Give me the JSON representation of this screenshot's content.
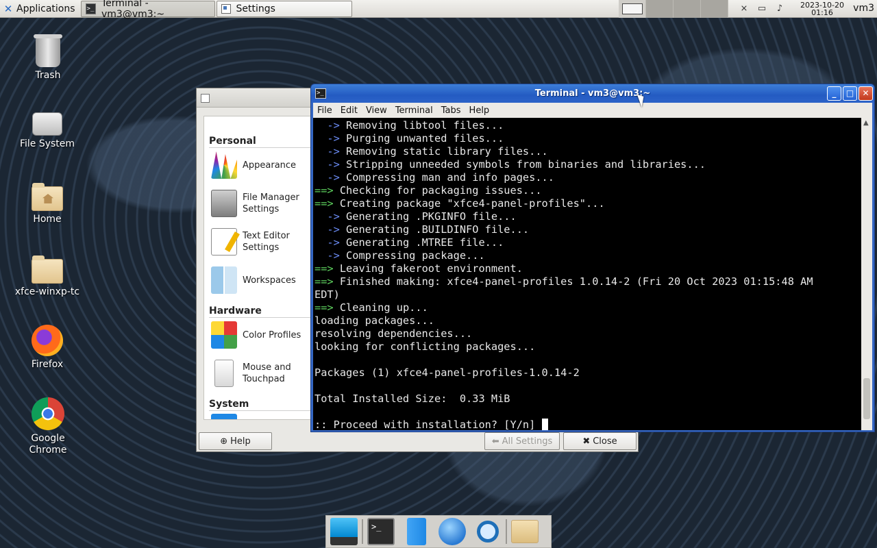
{
  "top_panel": {
    "applications_label": "Applications",
    "tasks": [
      {
        "label": "Terminal - vm3@vm3:~",
        "active": true
      },
      {
        "label": "Settings",
        "active": false
      }
    ],
    "workspace_count": 4,
    "current_workspace": 1,
    "tray_icons": [
      "network-disabled-icon",
      "battery-icon",
      "notification-icon"
    ],
    "clock_date": "2023-10-20",
    "clock_time": "01:16",
    "user": "vm3"
  },
  "desktop_icons": [
    {
      "label": "Trash",
      "icon": "trash-icon"
    },
    {
      "label": "File System",
      "icon": "drive-icon"
    },
    {
      "label": "Home",
      "icon": "home-folder-icon"
    },
    {
      "label": "xfce-winxp-tc",
      "icon": "folder-icon"
    },
    {
      "label": "Firefox",
      "icon": "firefox-icon"
    },
    {
      "label": "Google Chrome",
      "icon": "chrome-icon"
    }
  ],
  "settings_window": {
    "sections": {
      "personal": "Personal",
      "hardware": "Hardware",
      "system": "System"
    },
    "items": [
      {
        "label": "Appearance",
        "icon": "appearance-icon"
      },
      {
        "label": "File Manager Settings",
        "icon": "file-manager-icon"
      },
      {
        "label": "Text Editor Settings",
        "icon": "text-editor-icon"
      },
      {
        "label": "Workspaces",
        "icon": "workspaces-icon"
      },
      {
        "label": "Color Profiles",
        "icon": "color-profiles-icon"
      },
      {
        "label": "Mouse and Touchpad",
        "icon": "mouse-icon"
      }
    ],
    "help_label": "Help",
    "all_settings_label": "All Settings",
    "close_label": "Close"
  },
  "terminal": {
    "title": "Terminal - vm3@vm3:~",
    "menu": [
      "File",
      "Edit",
      "View",
      "Terminal",
      "Tabs",
      "Help"
    ],
    "lines": [
      {
        "prefix": "  ->",
        "kind": "sub",
        "text": " Removing libtool files..."
      },
      {
        "prefix": "  ->",
        "kind": "sub",
        "text": " Purging unwanted files..."
      },
      {
        "prefix": "  ->",
        "kind": "sub",
        "text": " Removing static library files..."
      },
      {
        "prefix": "  ->",
        "kind": "sub",
        "text": " Stripping unneeded symbols from binaries and libraries..."
      },
      {
        "prefix": "  ->",
        "kind": "sub",
        "text": " Compressing man and info pages..."
      },
      {
        "prefix": "==>",
        "kind": "main",
        "text": " Checking for packaging issues..."
      },
      {
        "prefix": "==>",
        "kind": "main",
        "text": " Creating package \"xfce4-panel-profiles\"..."
      },
      {
        "prefix": "  ->",
        "kind": "sub",
        "text": " Generating .PKGINFO file..."
      },
      {
        "prefix": "  ->",
        "kind": "sub",
        "text": " Generating .BUILDINFO file..."
      },
      {
        "prefix": "  ->",
        "kind": "sub",
        "text": " Generating .MTREE file..."
      },
      {
        "prefix": "  ->",
        "kind": "sub",
        "text": " Compressing package..."
      },
      {
        "prefix": "==>",
        "kind": "main",
        "text": " Leaving fakeroot environment."
      },
      {
        "prefix": "==>",
        "kind": "main",
        "text": " Finished making: xfce4-panel-profiles 1.0.14-2 (Fri 20 Oct 2023 01:15:48 AM"
      },
      {
        "prefix": "",
        "kind": "plain",
        "text": "EDT)"
      },
      {
        "prefix": "==>",
        "kind": "main",
        "text": " Cleaning up..."
      },
      {
        "prefix": "",
        "kind": "plain",
        "text": "loading packages..."
      },
      {
        "prefix": "",
        "kind": "plain",
        "text": "resolving dependencies..."
      },
      {
        "prefix": "",
        "kind": "plain",
        "text": "looking for conflicting packages..."
      },
      {
        "prefix": "",
        "kind": "plain",
        "text": ""
      },
      {
        "prefix": "",
        "kind": "plain",
        "text": "Packages (1) xfce4-panel-profiles-1.0.14-2"
      },
      {
        "prefix": "",
        "kind": "plain",
        "text": ""
      },
      {
        "prefix": "",
        "kind": "plain",
        "text": "Total Installed Size:  0.33 MiB"
      },
      {
        "prefix": "",
        "kind": "plain",
        "text": ""
      }
    ],
    "prompt": ":: Proceed with installation? [Y/n] "
  },
  "dock": {
    "items": [
      "show-desktop-icon",
      "terminal-icon",
      "file-manager-icon",
      "web-browser-icon",
      "search-icon",
      "folder-icon"
    ]
  },
  "colors": {
    "terminal_sub_arrow": "#6c8cf5",
    "terminal_main_arrow": "#5fd35f",
    "titlebar_blue": "#245bc2"
  }
}
